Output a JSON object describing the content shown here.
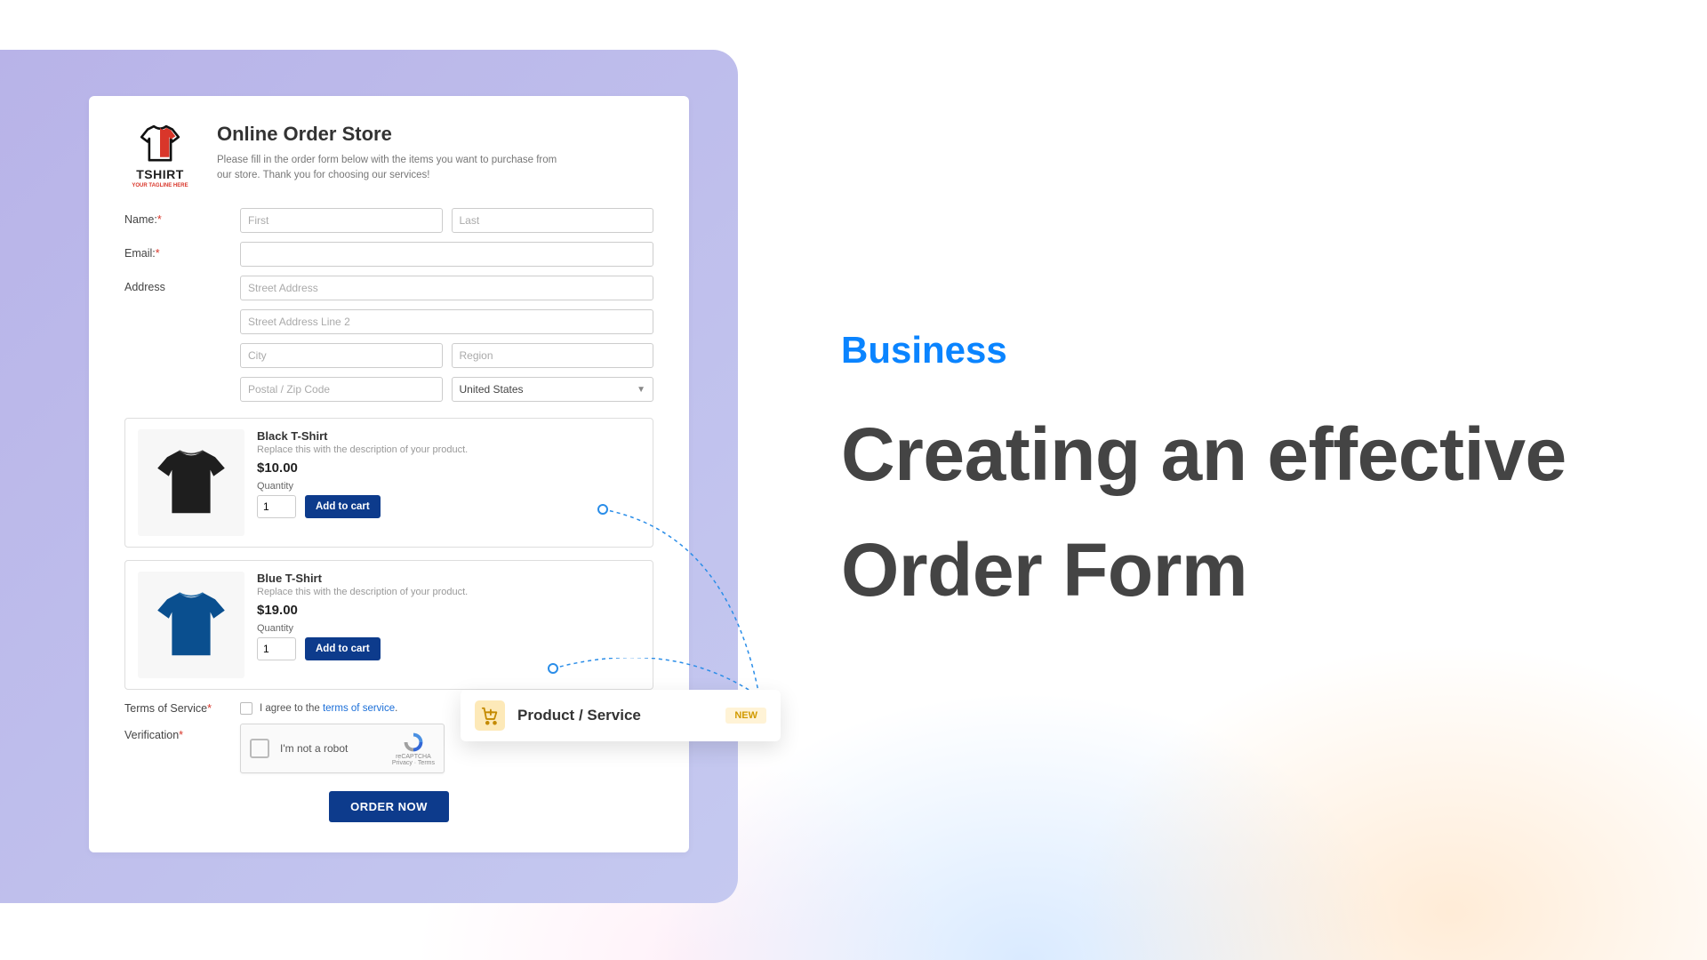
{
  "logo": {
    "brand": "TSHIRT",
    "tagline": "YOUR TAGLINE HERE"
  },
  "form": {
    "title": "Online Order Store",
    "intro": "Please fill in the order form below with the items you want to purchase from our store. Thank you for choosing our services!",
    "labels": {
      "name": "Name:",
      "email": "Email:",
      "address": "Address",
      "terms": "Terms of Service",
      "verification": "Verification"
    },
    "placeholders": {
      "first": "First",
      "last": "Last",
      "street1": "Street Address",
      "street2": "Street Address Line 2",
      "city": "City",
      "region": "Region",
      "postal": "Postal / Zip Code"
    },
    "country_selected": "United States",
    "products": [
      {
        "name": "Black T-Shirt",
        "desc": "Replace this with the description of your product.",
        "price": "$10.00",
        "qty_label": "Quantity",
        "qty_value": "1",
        "add_label": "Add to cart",
        "color": "#1e1e1e"
      },
      {
        "name": "Blue T-Shirt",
        "desc": "Replace this with the description of your product.",
        "price": "$19.00",
        "qty_label": "Quantity",
        "qty_value": "1",
        "add_label": "Add to cart",
        "color": "#0a4f8f"
      }
    ],
    "terms_prefix": "I agree to the ",
    "terms_link": "terms of service",
    "terms_suffix": ".",
    "captcha_text": "I'm not a robot",
    "captcha_brand": "reCAPTCHA",
    "captcha_legal": "Privacy · Terms",
    "order_button": "ORDER NOW"
  },
  "callout": {
    "label": "Product / Service",
    "badge": "NEW"
  },
  "headline": {
    "category": "Business",
    "title_line1": "Creating an effective",
    "title_line2": "Order Form"
  }
}
